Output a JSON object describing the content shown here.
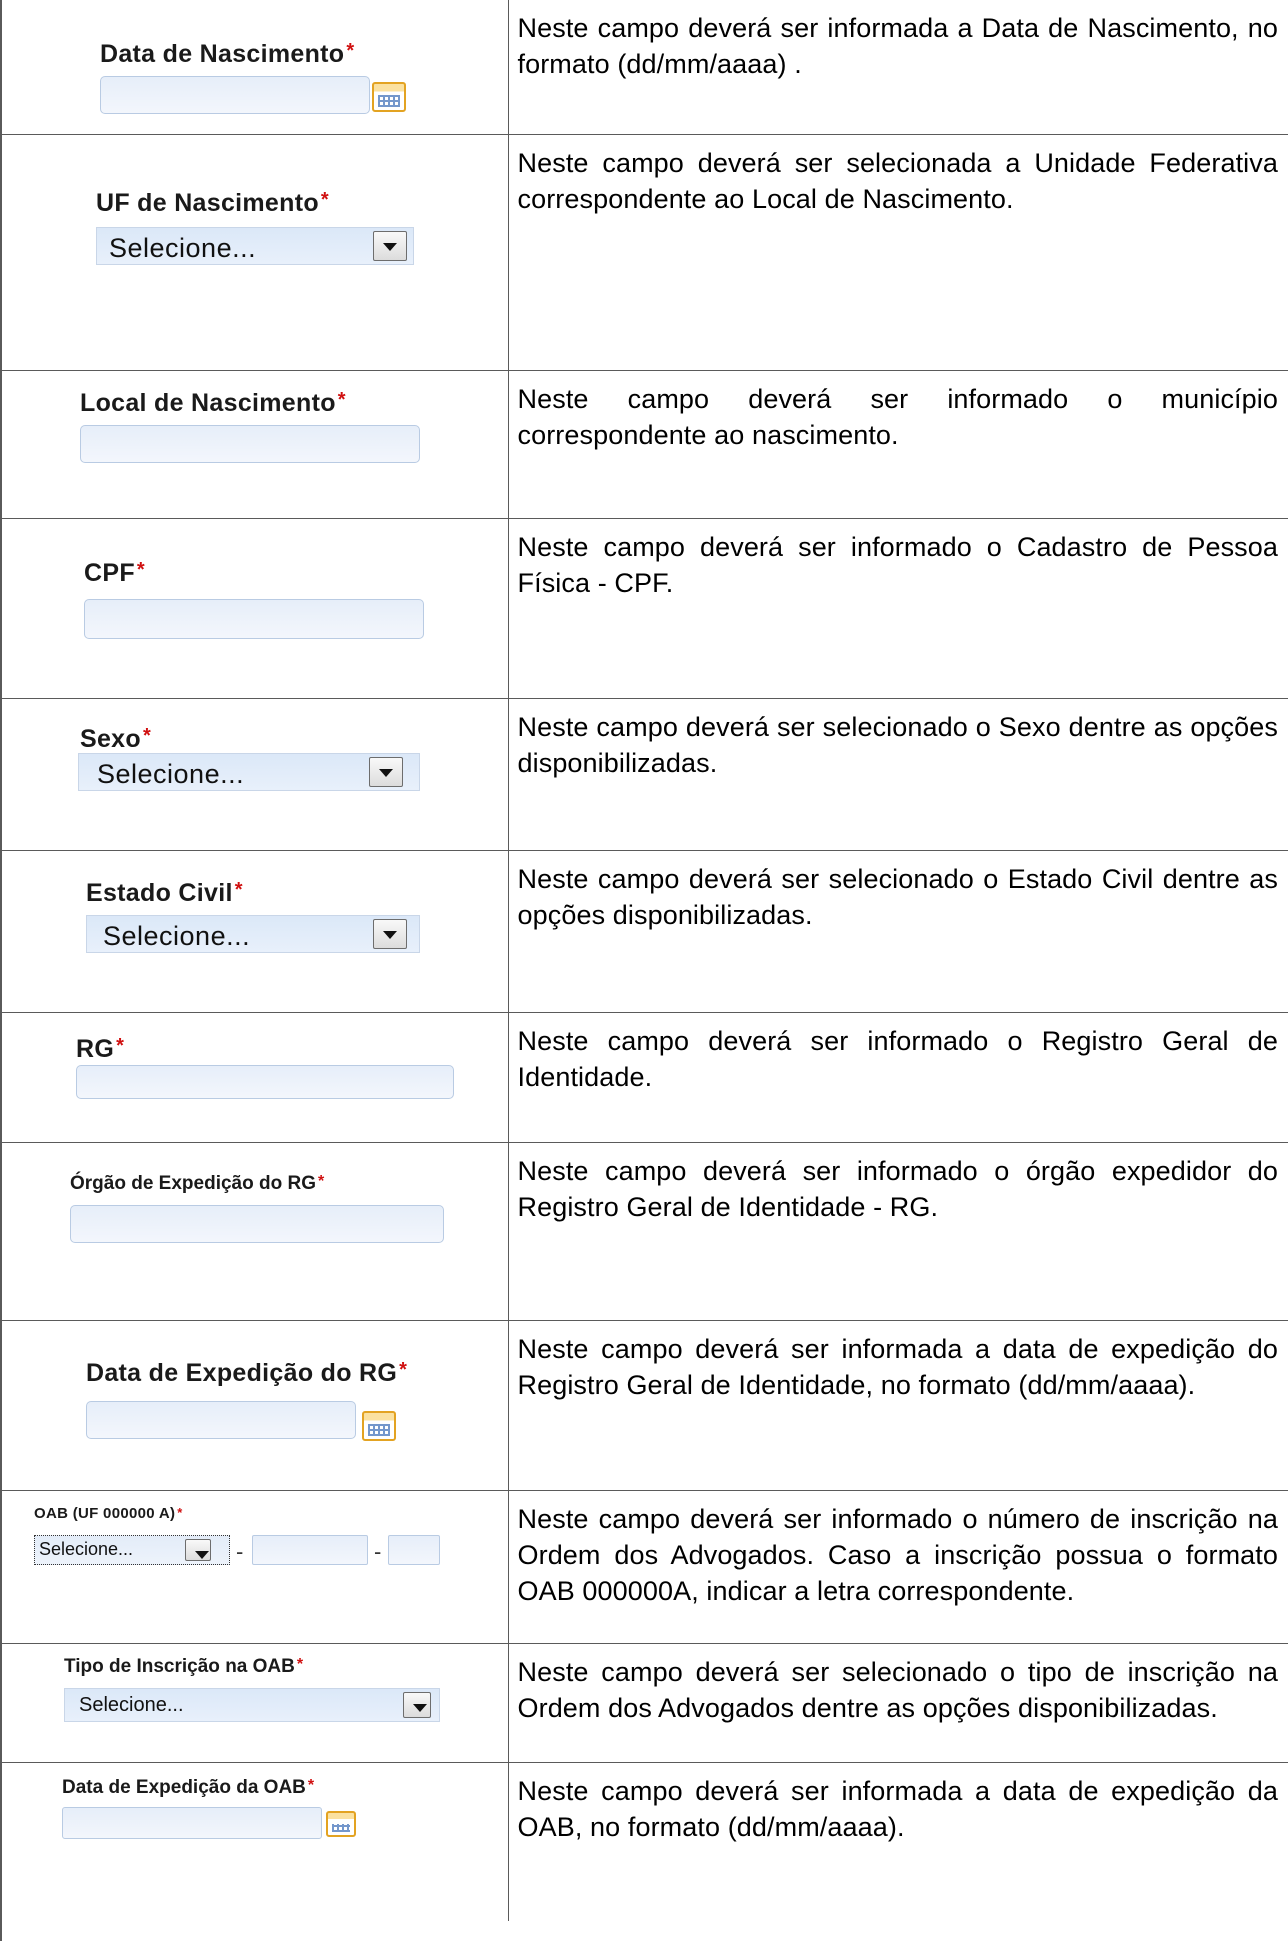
{
  "rows": [
    {
      "field": {
        "label": "Data de Nascimento",
        "required_mark": "*",
        "kind": "date-input",
        "icon": "calendar-icon"
      },
      "description": "Neste campo deverá ser informada a Data de Nascimento, no formato (dd/mm/aaaa) ."
    },
    {
      "field": {
        "label": "UF de Nascimento",
        "required_mark": "*",
        "kind": "select",
        "value": "Selecione..."
      },
      "description": "Neste campo deverá ser selecionada a Unidade Federativa correspondente ao Local de Nascimento."
    },
    {
      "field": {
        "label": "Local de Nascimento",
        "required_mark": "*",
        "kind": "text-input"
      },
      "description": "Neste campo deverá ser informado o município correspondente ao nascimento."
    },
    {
      "field": {
        "label": "CPF",
        "required_mark": "*",
        "kind": "text-input"
      },
      "description": "Neste campo deverá ser informado o Cadastro de Pessoa Física - CPF."
    },
    {
      "field": {
        "label": "Sexo",
        "required_mark": "*",
        "kind": "select",
        "value": "Selecione..."
      },
      "description": "Neste campo deverá ser selecionado o Sexo dentre as opções disponibilizadas."
    },
    {
      "field": {
        "label": "Estado Civil",
        "required_mark": "*",
        "kind": "select",
        "value": "Selecione..."
      },
      "description": "Neste campo deverá ser selecionado o Estado Civil dentre as opções disponibilizadas."
    },
    {
      "field": {
        "label": "RG",
        "required_mark": "*",
        "kind": "text-input"
      },
      "description": "Neste campo deverá ser informado o Registro Geral de Identidade."
    },
    {
      "field": {
        "label": "Órgão de Expedição do RG",
        "required_mark": "*",
        "kind": "text-input"
      },
      "description": "Neste campo deverá ser informado o órgão expedidor do  Registro Geral de Identidade - RG."
    },
    {
      "field": {
        "label": "Data de Expedição do RG",
        "required_mark": "*",
        "kind": "date-input",
        "icon": "calendar-icon"
      },
      "description": "Neste campo deverá ser informada a data de expedição do Registro Geral de Identidade, no formato (dd/mm/aaaa)."
    },
    {
      "field": {
        "label": "OAB (UF 000000 A)",
        "required_mark": "*",
        "kind": "composite",
        "value": "Selecione...",
        "separator": "-"
      },
      "description": "Neste campo deverá ser informado o número de inscrição na Ordem dos Advogados. Caso a inscrição possua o formato OAB 000000A, indicar a letra correspondente."
    },
    {
      "field": {
        "label": "Tipo de Inscrição na OAB",
        "required_mark": "*",
        "kind": "select",
        "value": "Selecione..."
      },
      "description": "Neste campo deverá ser selecionado o tipo de inscrição na Ordem dos Advogados dentre as opções disponibilizadas."
    },
    {
      "field": {
        "label": "Data de Expedição da OAB",
        "required_mark": "*",
        "kind": "date-input",
        "icon": "calendar-icon"
      },
      "description": "Neste campo deverá ser informada a data de expedição da OAB, no formato (dd/mm/aaaa)."
    }
  ]
}
